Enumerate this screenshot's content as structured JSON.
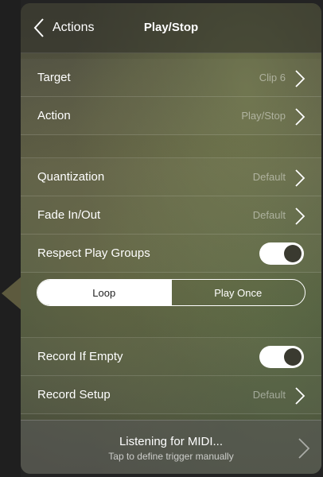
{
  "nav": {
    "back_label": "Actions",
    "title": "Play/Stop"
  },
  "rows": {
    "target": {
      "label": "Target",
      "value": "Clip 6"
    },
    "action": {
      "label": "Action",
      "value": "Play/Stop"
    },
    "quantization": {
      "label": "Quantization",
      "value": "Default"
    },
    "fade": {
      "label": "Fade In/Out",
      "value": "Default"
    },
    "respect_play_groups": {
      "label": "Respect Play Groups",
      "on": true
    },
    "record_if_empty": {
      "label": "Record If Empty",
      "on": true
    },
    "record_setup": {
      "label": "Record Setup",
      "value": "Default"
    }
  },
  "segmented": {
    "options": [
      "Loop",
      "Play Once"
    ],
    "selected": "Loop"
  },
  "footer": {
    "title": "Listening for MIDI...",
    "subtitle": "Tap to define trigger manually"
  },
  "icons": [
    "chevron-left-icon",
    "chevron-right-icon"
  ]
}
